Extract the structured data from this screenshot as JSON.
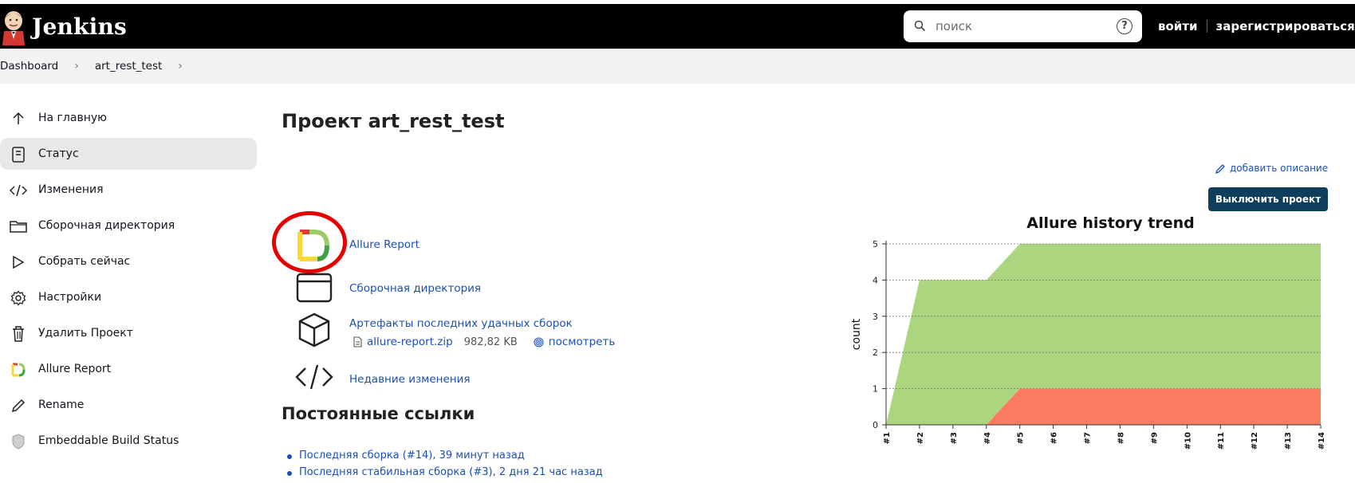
{
  "header": {
    "logo_text": "Jenkins",
    "search_placeholder": "поиск",
    "help_label": "?",
    "login_label": "войти",
    "register_label": "зарегистрироваться"
  },
  "breadcrumbs": [
    {
      "label": "Dashboard"
    },
    {
      "label": "art_rest_test"
    }
  ],
  "sidebar": {
    "items": [
      {
        "label": "На главную",
        "icon": "arrow-up-icon"
      },
      {
        "label": "Статус",
        "icon": "document-icon",
        "active": true
      },
      {
        "label": "Изменения",
        "icon": "code-icon"
      },
      {
        "label": "Сборочная директория",
        "icon": "folder-icon"
      },
      {
        "label": "Собрать сейчас",
        "icon": "play-icon"
      },
      {
        "label": "Настройки",
        "icon": "gear-icon"
      },
      {
        "label": "Удалить Проект",
        "icon": "trash-icon"
      },
      {
        "label": "Allure Report",
        "icon": "allure-icon"
      },
      {
        "label": "Rename",
        "icon": "pencil-icon"
      },
      {
        "label": "Embeddable Build Status",
        "icon": "shield-icon"
      }
    ]
  },
  "main": {
    "title": "Проект art_rest_test",
    "add_description": "добавить описание",
    "disable_button": "Выключить проект",
    "links": {
      "allure": "Allure Report",
      "workspace": "Сборочная директория",
      "artifacts": "Артефакты последних удачных сборок",
      "artifact_file": "allure-report.zip",
      "artifact_size": "982,82 KB",
      "artifact_view": "посмотреть",
      "changes": "Недавние изменения"
    },
    "permalinks_title": "Постоянные ссылки",
    "permalinks": [
      "Последняя сборка (#14), 39 минут назад",
      "Последняя стабильная сборка (#3), 2 дня 21 час назад"
    ]
  },
  "colors": {
    "header_bg": "#000000",
    "button_bg": "#0f3d5c",
    "link": "#1b4fb5",
    "passed": "#acd580",
    "failed": "#fb7b61",
    "highlight": "#e60000"
  },
  "chart_data": {
    "type": "area",
    "title": "Allure history trend",
    "xlabel": "",
    "ylabel": "count",
    "categories": [
      "#1",
      "#2",
      "#3",
      "#4",
      "#5",
      "#6",
      "#7",
      "#8",
      "#9",
      "#10",
      "#11",
      "#12",
      "#13",
      "#14"
    ],
    "series": [
      {
        "name": "",
        "color": "#fb7b61",
        "values": [
          0,
          0,
          0,
          0,
          1,
          1,
          1,
          1,
          1,
          1,
          1,
          1,
          1,
          1
        ]
      },
      {
        "name": "",
        "color": "#acd580",
        "values": [
          0,
          4,
          4,
          4,
          4,
          4,
          4,
          4,
          4,
          4,
          4,
          4,
          4,
          4
        ]
      }
    ],
    "stacked": true,
    "ylim": [
      0,
      5
    ],
    "yticks": [
      0,
      1,
      2,
      3,
      4,
      5
    ],
    "grid": true
  }
}
